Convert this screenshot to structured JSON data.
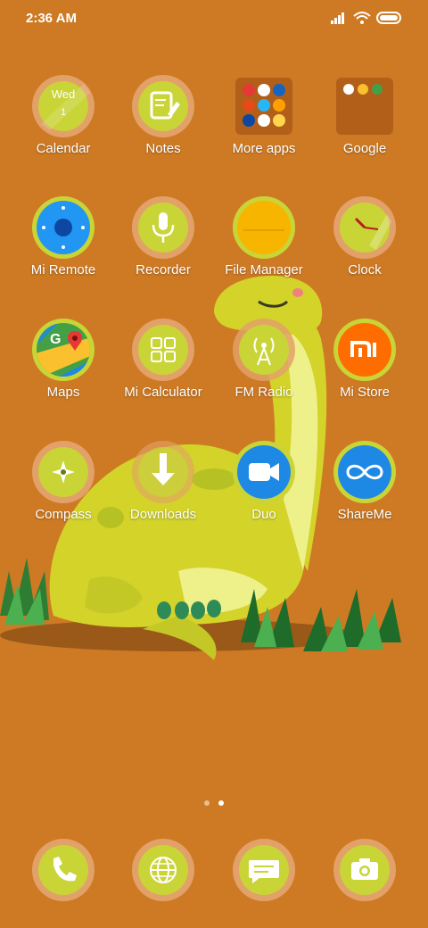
{
  "status_bar": {
    "time": "2:36 AM",
    "icons": [
      "signal-icon",
      "wifi-icon",
      "battery-icon"
    ]
  },
  "apps": {
    "calendar": {
      "label": "Calendar",
      "weekday": "Wed",
      "day": "1",
      "icon": "calendar-icon"
    },
    "notes": {
      "label": "Notes",
      "icon": "notes-icon"
    },
    "more_apps": {
      "label": "More apps",
      "icon": "folder-icon"
    },
    "google": {
      "label": "Google",
      "icon": "folder-icon"
    },
    "mi_remote": {
      "label": "Mi Remote",
      "icon": "remote-icon"
    },
    "recorder": {
      "label": "Recorder",
      "icon": "microphone-icon"
    },
    "file_manager": {
      "label": "File Manager",
      "icon": "folder-icon"
    },
    "clock": {
      "label": "Clock",
      "icon": "clock-icon"
    },
    "maps": {
      "label": "Maps",
      "icon": "maps-icon"
    },
    "mi_calculator": {
      "label": "Mi Calculator",
      "icon": "calculator-icon"
    },
    "fm_radio": {
      "label": "FM Radio",
      "icon": "radio-icon"
    },
    "mi_store": {
      "label": "Mi Store",
      "icon": "mi-logo-icon"
    },
    "compass": {
      "label": "Compass",
      "icon": "compass-icon"
    },
    "downloads": {
      "label": "Downloads",
      "icon": "download-icon"
    },
    "duo": {
      "label": "Duo",
      "icon": "video-camera-icon"
    },
    "shareme": {
      "label": "ShareMe",
      "icon": "infinity-icon"
    }
  },
  "dock": [
    "phone-icon",
    "globe-icon",
    "message-icon",
    "camera-icon"
  ],
  "page_indicator": {
    "pages": 2,
    "current": 2
  },
  "colors": {
    "background": "#CE7A24",
    "icon_ring": "#E2A168",
    "icon_fill": "#C9D437",
    "dinosaur": "#D3D32A"
  }
}
